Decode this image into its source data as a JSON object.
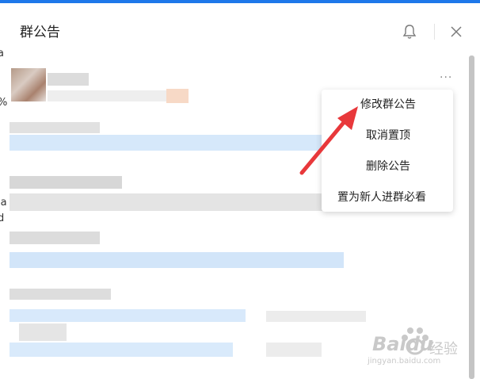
{
  "window": {
    "title": "群公告",
    "icons": {
      "notify": "bell-icon",
      "close": "close-icon"
    }
  },
  "left_edge": [
    "a",
    "%",
    "la",
    "d"
  ],
  "post": {
    "more_label": "···",
    "more_icon": "more-horizontal-icon"
  },
  "context_menu": {
    "items": [
      {
        "label": "修改群公告"
      },
      {
        "label": "取消置顶"
      },
      {
        "label": "删除公告"
      },
      {
        "label": "置为新人进群必看"
      }
    ]
  },
  "annotation": {
    "type": "red-arrow",
    "target": "修改群公告",
    "color": "#e8383b"
  },
  "watermark": {
    "brand": "Baidu",
    "brand_cn": "经验",
    "url": "jingyan.baidu.com"
  },
  "colors": {
    "accent": "#1e78ea",
    "arrow": "#e8383b",
    "link_blur": "#cfe3f8"
  }
}
